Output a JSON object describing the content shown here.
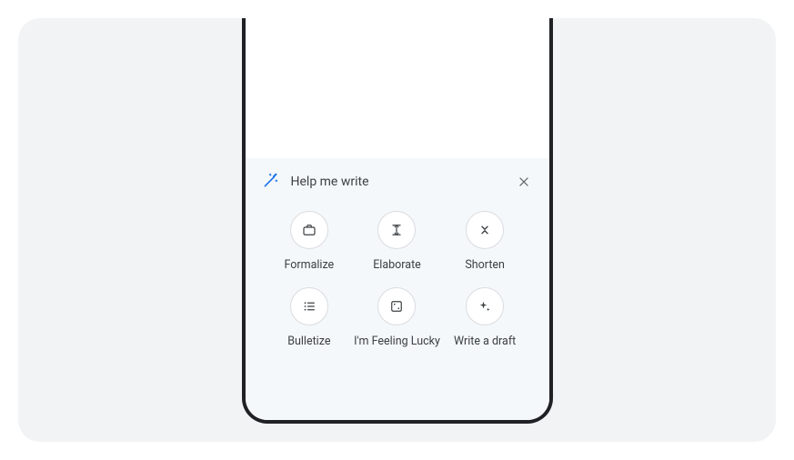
{
  "panel": {
    "title": "Help me write",
    "options": [
      {
        "label": "Formalize"
      },
      {
        "label": "Elaborate"
      },
      {
        "label": "Shorten"
      },
      {
        "label": "Bulletize"
      },
      {
        "label": "I'm Feeling Lucky"
      },
      {
        "label": "Write a draft"
      }
    ]
  }
}
